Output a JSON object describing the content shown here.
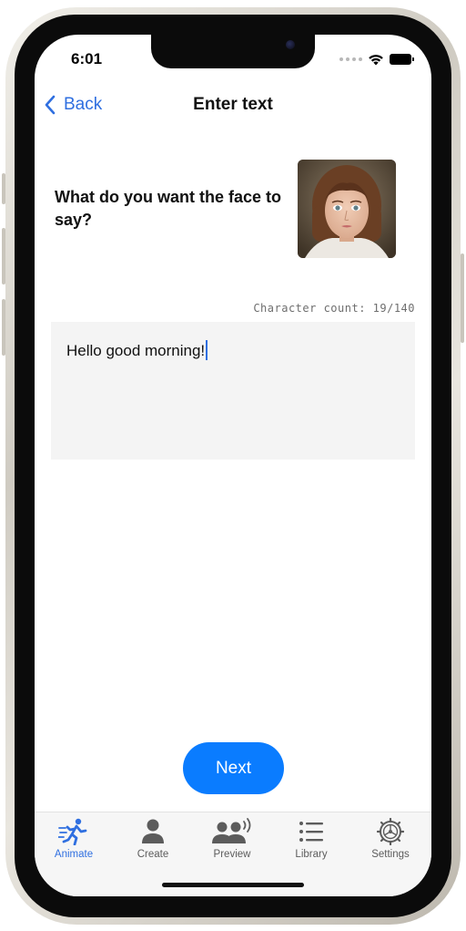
{
  "status_bar": {
    "time": "6:01"
  },
  "nav": {
    "back_label": "Back",
    "title": "Enter text"
  },
  "prompt": {
    "question": "What do you want the face to say?"
  },
  "editor": {
    "character_count": "Character count: 19/140",
    "text": "Hello good morning!"
  },
  "actions": {
    "next_label": "Next"
  },
  "tabs": [
    {
      "label": "Animate",
      "icon": "running-person-icon",
      "active": true
    },
    {
      "label": "Create",
      "icon": "person-icon",
      "active": false
    },
    {
      "label": "Preview",
      "icon": "people-speaking-icon",
      "active": false
    },
    {
      "label": "Library",
      "icon": "list-icon",
      "active": false
    },
    {
      "label": "Settings",
      "icon": "gear-icon",
      "active": false
    }
  ],
  "colors": {
    "accent": "#2f6fe0",
    "button": "#0a7cff",
    "editor_bg": "#f4f4f4",
    "tab_bar_bg": "#f6f6f6"
  }
}
